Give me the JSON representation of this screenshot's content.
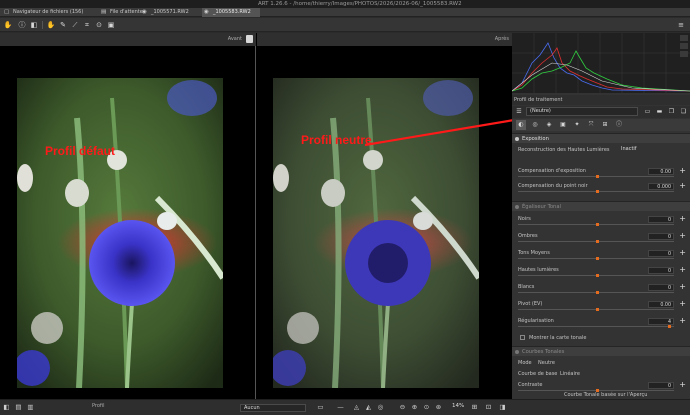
{
  "window": {
    "title": "ART 1.26.6 - /home/thierry/Images/PHOTOS/2026/2026-06/_1005583.RW2"
  },
  "tabs": [
    {
      "label": "Navigateur de fichiers (156)",
      "icon": "▢"
    },
    {
      "label": "File d'attente",
      "icon": "▤"
    },
    {
      "label": "_1005571.RW2",
      "icon": "◉"
    },
    {
      "label": "_1005583.RW2",
      "icon": "◉"
    }
  ],
  "viewer": {
    "before_label": "Avant",
    "after_label": "Après",
    "annotation_left": "Profil défaut",
    "annotation_right": "Profil neutre"
  },
  "right_panel": {
    "profile_title": "Profil de traitement",
    "profile_value": "(Neutre)",
    "exposure": {
      "title": "Exposition",
      "highlight_label": "Reconstruction des Hautes Lumières",
      "highlight_value": "Inactif",
      "rows": [
        {
          "label": "Compensation d'exposition",
          "value": "0.00"
        },
        {
          "label": "Compensation du point noir",
          "value": "0.000"
        }
      ]
    },
    "tone_equalizer": {
      "title": "Égaliseur Tonal",
      "rows": [
        {
          "label": "Noirs",
          "value": "0"
        },
        {
          "label": "Ombres",
          "value": "0"
        },
        {
          "label": "Tons Moyens",
          "value": "0"
        },
        {
          "label": "Hautes lumières",
          "value": "0"
        },
        {
          "label": "Blancs",
          "value": "0"
        },
        {
          "label": "Pivot (EV)",
          "value": "0.00"
        },
        {
          "label": "Régularisation",
          "value": "4"
        }
      ],
      "show_map": "Montrer la carte tonale"
    },
    "tone_curves": {
      "title": "Courbes Tonales",
      "mode_label": "Mode",
      "mode_value": "Neutre",
      "base_curve_label": "Courbe de base",
      "base_curve_value": "Linéaire",
      "contrast_label": "Contraste",
      "contrast_value": "0",
      "footer": "Courbe Tonale basée sur l'Aperçu"
    }
  },
  "bottom": {
    "profile_label": "Profil",
    "display_label": "Aucun",
    "zoom": "14%"
  },
  "colors": {
    "accent": "#e56b1f",
    "annotation": "#ff1a1a"
  }
}
